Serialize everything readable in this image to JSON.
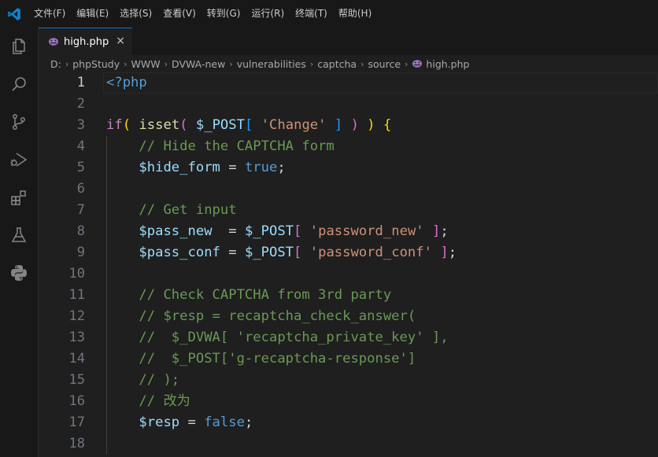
{
  "menu": [
    "文件(F)",
    "编辑(E)",
    "选择(S)",
    "查看(V)",
    "转到(G)",
    "运行(R)",
    "终端(T)",
    "帮助(H)"
  ],
  "tab": {
    "filename": "high.php",
    "close": "×"
  },
  "breadcrumb": [
    "D:",
    "phpStudy",
    "WWW",
    "DVWA-new",
    "vulnerabilities",
    "captcha",
    "source",
    "high.php"
  ],
  "activity_icons": [
    "explorer-icon",
    "search-icon",
    "source-control-icon",
    "run-debug-icon",
    "extensions-icon",
    "testing-icon",
    "python-icon"
  ],
  "colors": {
    "keyword": "#c586c0",
    "function": "#dcdcaa",
    "variable": "#9cdcfe",
    "string": "#ce9178",
    "comment": "#6a9955",
    "constant": "#569cd6",
    "accent": "#0078d4"
  },
  "current_line": 1,
  "lines": [
    {
      "n": "1",
      "tokens": [
        [
          "c-tag",
          "<?php"
        ]
      ]
    },
    {
      "n": "2",
      "tokens": []
    },
    {
      "n": "3",
      "tokens": [
        [
          "c-kw",
          "if"
        ],
        [
          "c-b1",
          "("
        ],
        [
          "c-op",
          " "
        ],
        [
          "c-fn",
          "isset"
        ],
        [
          "c-b2",
          "("
        ],
        [
          "c-op",
          " "
        ],
        [
          "c-var",
          "$_POST"
        ],
        [
          "c-b3",
          "["
        ],
        [
          "c-op",
          " "
        ],
        [
          "c-str",
          "'Change'"
        ],
        [
          "c-op",
          " "
        ],
        [
          "c-b3",
          "]"
        ],
        [
          "c-op",
          " "
        ],
        [
          "c-b2",
          ")"
        ],
        [
          "c-op",
          " "
        ],
        [
          "c-b1",
          ")"
        ],
        [
          "c-op",
          " "
        ],
        [
          "c-b1",
          "{"
        ]
      ]
    },
    {
      "n": "4",
      "tokens": [
        [
          "c-op",
          "    "
        ],
        [
          "c-cmt",
          "// Hide the CAPTCHA form"
        ]
      ]
    },
    {
      "n": "5",
      "tokens": [
        [
          "c-op",
          "    "
        ],
        [
          "c-var",
          "$hide_form"
        ],
        [
          "c-op",
          " = "
        ],
        [
          "c-const",
          "true"
        ],
        [
          "c-op",
          ";"
        ]
      ]
    },
    {
      "n": "6",
      "tokens": []
    },
    {
      "n": "7",
      "tokens": [
        [
          "c-op",
          "    "
        ],
        [
          "c-cmt",
          "// Get input"
        ]
      ]
    },
    {
      "n": "8",
      "tokens": [
        [
          "c-op",
          "    "
        ],
        [
          "c-var",
          "$pass_new"
        ],
        [
          "c-op",
          "  = "
        ],
        [
          "c-var",
          "$_POST"
        ],
        [
          "c-b2",
          "["
        ],
        [
          "c-op",
          " "
        ],
        [
          "c-str",
          "'password_new'"
        ],
        [
          "c-op",
          " "
        ],
        [
          "c-b2",
          "]"
        ],
        [
          "c-op",
          ";"
        ]
      ]
    },
    {
      "n": "9",
      "tokens": [
        [
          "c-op",
          "    "
        ],
        [
          "c-var",
          "$pass_conf"
        ],
        [
          "c-op",
          " = "
        ],
        [
          "c-var",
          "$_POST"
        ],
        [
          "c-b2",
          "["
        ],
        [
          "c-op",
          " "
        ],
        [
          "c-str",
          "'password_conf'"
        ],
        [
          "c-op",
          " "
        ],
        [
          "c-b2",
          "]"
        ],
        [
          "c-op",
          ";"
        ]
      ]
    },
    {
      "n": "10",
      "tokens": []
    },
    {
      "n": "11",
      "tokens": [
        [
          "c-op",
          "    "
        ],
        [
          "c-cmt",
          "// Check CAPTCHA from 3rd party"
        ]
      ]
    },
    {
      "n": "12",
      "tokens": [
        [
          "c-op",
          "    "
        ],
        [
          "c-cmt",
          "// $resp = recaptcha_check_answer("
        ]
      ]
    },
    {
      "n": "13",
      "tokens": [
        [
          "c-op",
          "    "
        ],
        [
          "c-cmt",
          "//  $_DVWA[ 'recaptcha_private_key' ],"
        ]
      ]
    },
    {
      "n": "14",
      "tokens": [
        [
          "c-op",
          "    "
        ],
        [
          "c-cmt",
          "//  $_POST['g-recaptcha-response']"
        ]
      ]
    },
    {
      "n": "15",
      "tokens": [
        [
          "c-op",
          "    "
        ],
        [
          "c-cmt",
          "// );"
        ]
      ]
    },
    {
      "n": "16",
      "tokens": [
        [
          "c-op",
          "    "
        ],
        [
          "c-cmt",
          "// 改为"
        ]
      ]
    },
    {
      "n": "17",
      "tokens": [
        [
          "c-op",
          "    "
        ],
        [
          "c-var",
          "$resp"
        ],
        [
          "c-op",
          " = "
        ],
        [
          "c-const",
          "false"
        ],
        [
          "c-op",
          ";"
        ]
      ]
    },
    {
      "n": "18",
      "tokens": []
    }
  ]
}
